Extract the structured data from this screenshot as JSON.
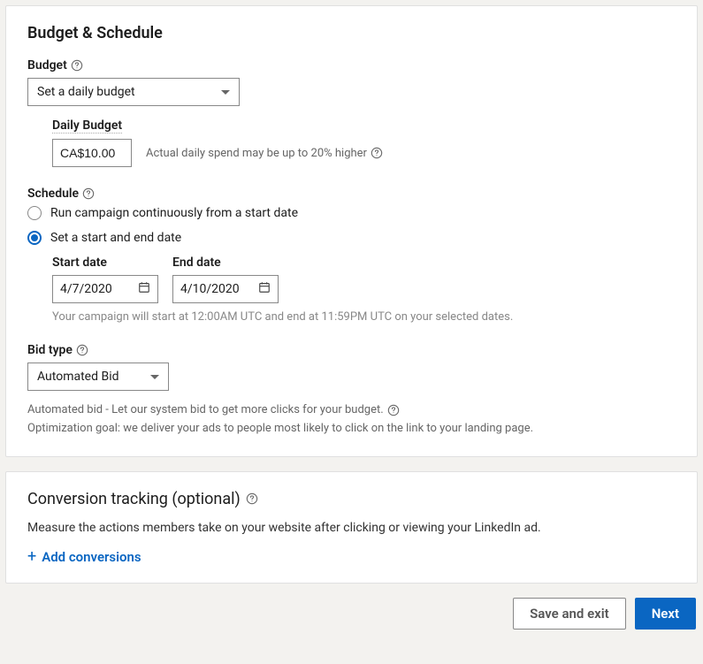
{
  "budget_schedule": {
    "title": "Budget & Schedule",
    "budget_label": "Budget",
    "budget_select": "Set a daily budget",
    "daily_budget_label": "Daily Budget",
    "daily_budget_value": "CA$10.00",
    "daily_budget_note": "Actual daily spend may be up to 20% higher",
    "schedule_label": "Schedule",
    "schedule_option1": "Run campaign continuously from a start date",
    "schedule_option2": "Set a start and end date",
    "start_date_label": "Start date",
    "start_date_value": "4/7/2020",
    "end_date_label": "End date",
    "end_date_value": "4/10/2020",
    "schedule_note": "Your campaign will start at 12:00AM UTC and end at 11:59PM UTC on your selected dates.",
    "bid_type_label": "Bid type",
    "bid_type_value": "Automated Bid",
    "bid_desc1": "Automated bid - Let our system bid to get more clicks for your budget.",
    "bid_desc2": "Optimization goal: we deliver your ads to people most likely to click on the link to your landing page."
  },
  "conversion": {
    "title": "Conversion tracking (optional)",
    "desc": "Measure the actions members take on your website after clicking or viewing your LinkedIn ad.",
    "add_label": "Add conversions"
  },
  "footer": {
    "save_exit": "Save and exit",
    "next": "Next"
  }
}
